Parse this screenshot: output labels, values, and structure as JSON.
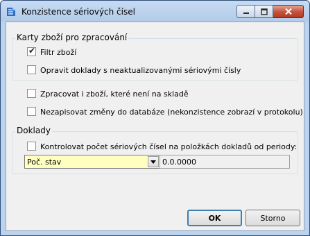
{
  "window": {
    "title": "Konzistence sériových čísel",
    "icon": "app-icon"
  },
  "group_items": {
    "title": "Karty zboží pro zpracování",
    "filter": {
      "label": "Filtr zboží",
      "checked": true
    },
    "fix_docs": {
      "label": "Opravit doklady s neaktualizovanými sériovými čísly",
      "checked": false
    }
  },
  "process_not_in_stock": {
    "label": "Zpracovat i zboží, které není na skladě",
    "checked": false
  },
  "no_db_write": {
    "label": "Nezapisovat změny do databáze (nekonzistence zobrazí v protokolu)",
    "checked": false
  },
  "group_docs": {
    "title": "Doklady",
    "check_count": {
      "label": "Kontrolovat počet sériových čísel na položkách dokladů od periody:",
      "checked": false
    },
    "period_select": {
      "value": "Poč. stav"
    },
    "date_value": "0.0.0000"
  },
  "buttons": {
    "ok": "OK",
    "cancel": "Storno"
  },
  "colors": {
    "titlebar": "#bcd3ee",
    "client": "#f0f0f0",
    "combo_bg": "#ffffc0",
    "close_btn": "#c4513a"
  }
}
